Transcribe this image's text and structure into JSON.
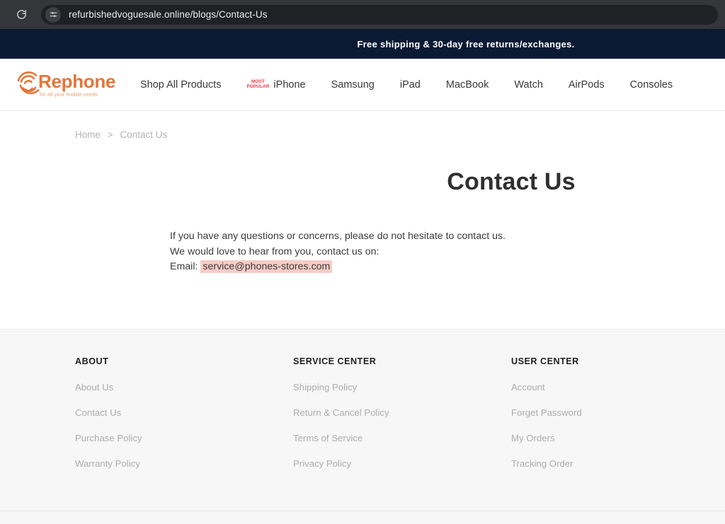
{
  "browser": {
    "reload_icon": "reload-icon",
    "site_settings_icon": "site-settings-sliders-icon",
    "url": "refurbishedvoguesale.online/blogs/Contact-Us"
  },
  "announcement": {
    "text": "Free shipping & 30-day free returns/exchanges.",
    "background": "#0b1a33",
    "color": "#ffffff"
  },
  "header": {
    "logo": {
      "word": "Rephone",
      "tagline": "for all your mobile needs",
      "mark_icon": "rephone-signal-wave-icon",
      "color": "#e2763a"
    },
    "nav": [
      {
        "label": "Shop All Products",
        "badge": null
      },
      {
        "label": "iPhone",
        "badge": "MOST\nPOPULAR"
      },
      {
        "label": "Samsung",
        "badge": null
      },
      {
        "label": "iPad",
        "badge": null
      },
      {
        "label": "MacBook",
        "badge": null
      },
      {
        "label": "Watch",
        "badge": null
      },
      {
        "label": "AirPods",
        "badge": null
      },
      {
        "label": "Consoles",
        "badge": null
      }
    ],
    "badge_color": "#ef3340"
  },
  "breadcrumb": {
    "home": "Home",
    "separator": ">",
    "current": "Contact Us"
  },
  "main": {
    "title": "Contact Us",
    "paragraph_1": "If you have any questions or concerns, please do not hesitate to contact us.",
    "paragraph_2": "We would love to hear from you, contact us on:",
    "email_label": "Email:",
    "email": "service@phones-stores.com",
    "email_highlight_color": "#f7ccc7"
  },
  "footer": {
    "columns": [
      {
        "heading": "ABOUT",
        "links": [
          "About Us",
          "Contact Us",
          "Purchase Policy",
          "Warranty Policy"
        ]
      },
      {
        "heading": "SERVICE CENTER",
        "links": [
          "Shipping Policy",
          "Return & Cancel Policy",
          "Terms of Service",
          "Privacy Policy"
        ]
      },
      {
        "heading": "USER CENTER",
        "links": [
          "Account",
          "Forget Password",
          "My Orders",
          "Tracking Order"
        ]
      }
    ],
    "background": "#f7f7f7"
  }
}
